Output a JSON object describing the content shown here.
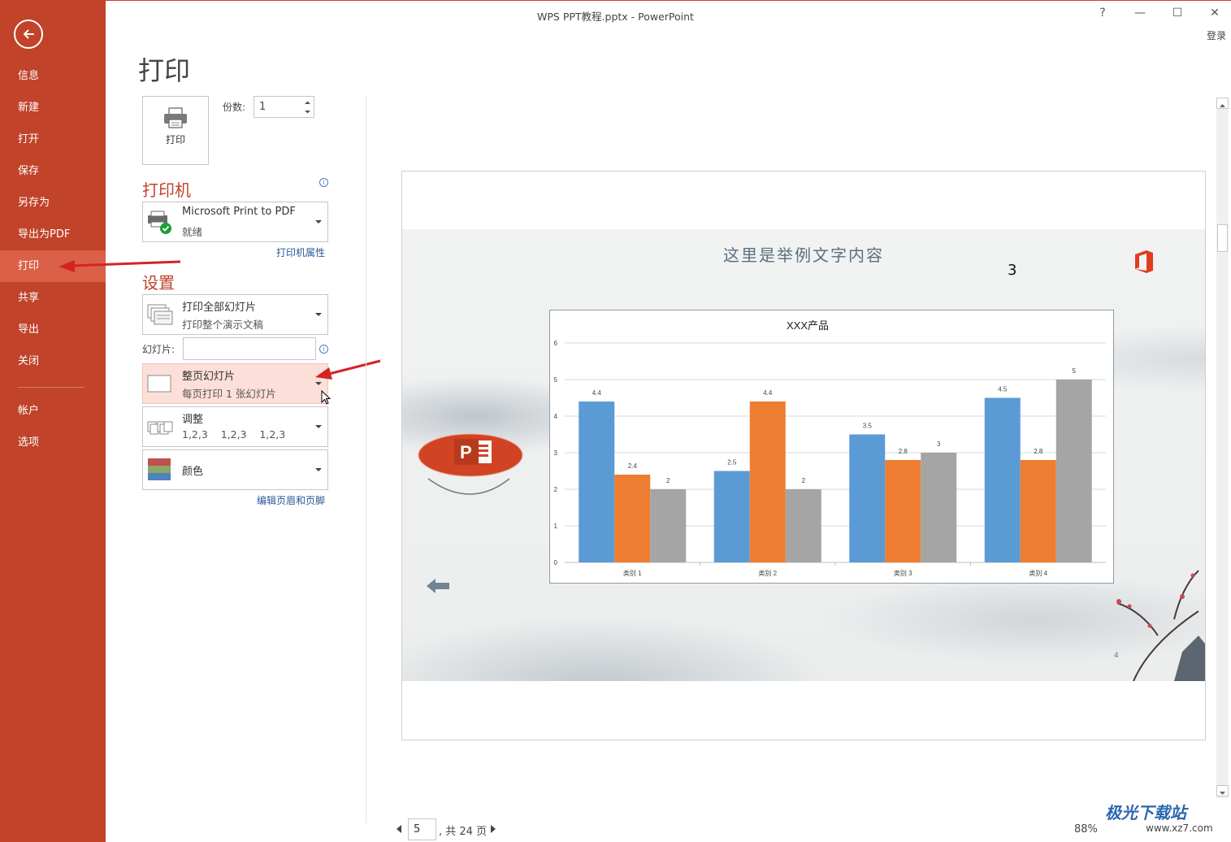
{
  "window": {
    "title": "WPS PPT教程.pptx - PowerPoint",
    "help": "?",
    "minimize": "—",
    "maximize": "☐",
    "close": "✕",
    "login": "登录"
  },
  "sidebar": {
    "items": [
      {
        "label": "信息"
      },
      {
        "label": "新建"
      },
      {
        "label": "打开"
      },
      {
        "label": "保存"
      },
      {
        "label": "另存为"
      },
      {
        "label": "导出为PDF"
      },
      {
        "label": "打印"
      },
      {
        "label": "共享"
      },
      {
        "label": "导出"
      },
      {
        "label": "关闭"
      },
      {
        "label": "帐户"
      },
      {
        "label": "选项"
      }
    ],
    "active": "打印",
    "accent": "#c0432a"
  },
  "print": {
    "page_title": "打印",
    "button_label": "打印",
    "copies_label": "份数:",
    "copies_value": "1"
  },
  "printer": {
    "heading": "打印机",
    "name": "Microsoft Print to PDF",
    "status": "就绪",
    "properties_link": "打印机属性",
    "info": "i"
  },
  "settings": {
    "heading": "设置",
    "range": {
      "title": "打印全部幻灯片",
      "subtitle": "打印整个演示文稿"
    },
    "slides_label": "幻灯片:",
    "slides_value": "",
    "layout": {
      "title": "整页幻灯片",
      "subtitle": "每页打印 1 张幻灯片"
    },
    "collate": {
      "title": "调整",
      "subtitle": "1,2,3    1,2,3    1,2,3"
    },
    "color": {
      "title": "颜色"
    },
    "header_footer_link": "编辑页眉和页脚",
    "info": "i"
  },
  "preview": {
    "slide_title": "这里是举例文字内容",
    "slide_number": "3",
    "footer_number": "4",
    "page_current": "5",
    "page_total": ", 共 24 页",
    "zoom": "88%"
  },
  "chart_data": {
    "type": "bar",
    "title": "XXX产品",
    "categories": [
      "类别 1",
      "类别 2",
      "类别 3",
      "类别 4"
    ],
    "series": [
      {
        "values": [
          4.4,
          2.5,
          3.5,
          4.5
        ],
        "color": "#5b9bd5"
      },
      {
        "values": [
          2.4,
          4.4,
          2.8,
          2.8
        ],
        "color": "#ed7d31"
      },
      {
        "values": [
          2,
          2,
          3,
          5
        ],
        "color": "#a5a5a5"
      }
    ],
    "ylim": [
      0,
      6
    ],
    "yticks": [
      "0",
      "1",
      "2",
      "3",
      "4",
      "5",
      "6"
    ],
    "grid": true
  },
  "watermark": {
    "text": "极光下载站",
    "url": "www.xz7.com"
  }
}
